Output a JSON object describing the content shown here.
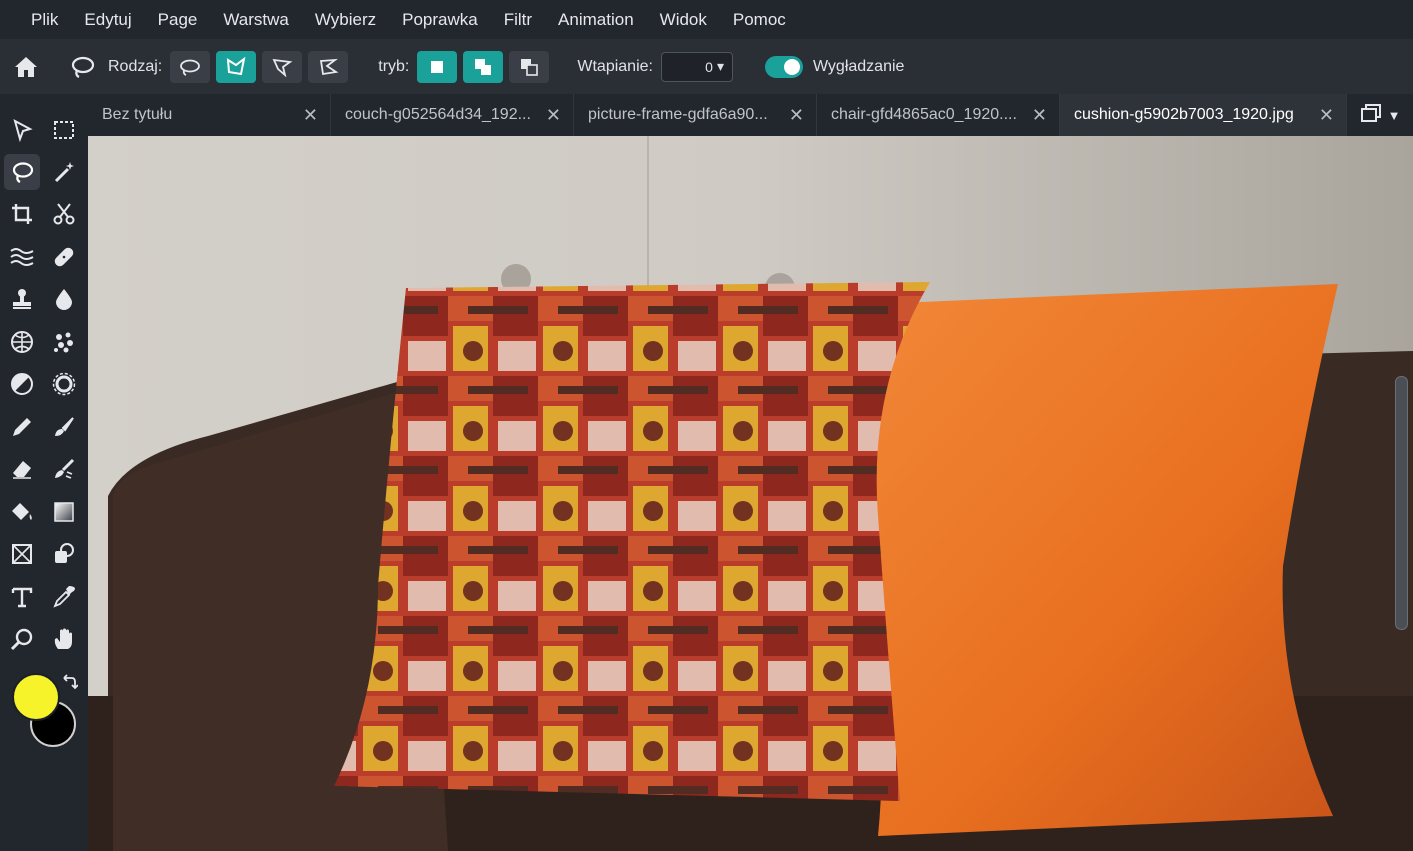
{
  "menu": [
    "Plik",
    "Edytuj",
    "Page",
    "Warstwa",
    "Wybierz",
    "Poprawka",
    "Filtr",
    "Animation",
    "Widok",
    "Pomoc"
  ],
  "options": {
    "type_label": "Rodzaj:",
    "mode_label": "tryb:",
    "feather_label": "Wtapianie:",
    "feather_value": "0",
    "smoothing_label": "Wygładzanie",
    "smoothing_on": true
  },
  "tabs": [
    {
      "label": "Bez tytułu",
      "active": false
    },
    {
      "label": "couch-g052564d34_192...",
      "active": false
    },
    {
      "label": "picture-frame-gdfa6a90...",
      "active": false
    },
    {
      "label": "chair-gfd4865ac0_1920....",
      "active": false
    },
    {
      "label": "cushion-g5902b7003_1920.jpg",
      "active": true
    }
  ],
  "tools": [
    "select-arrow-icon",
    "marquee-icon",
    "lasso-icon",
    "magic-wand-icon",
    "crop-icon",
    "scissors-icon",
    "liquify-icon",
    "heal-bandage-icon",
    "stamp-icon",
    "blur-drop-icon",
    "sphere-icon",
    "particles-icon",
    "dodge-icon",
    "sponge-icon",
    "pencil-icon",
    "brush-icon",
    "eraser-icon",
    "smudge-brush-icon",
    "bucket-icon",
    "gradient-icon",
    "transform-icon",
    "shape-icon",
    "text-icon",
    "eyedropper-icon",
    "zoom-icon",
    "hand-icon"
  ],
  "colors": {
    "foreground": "#f6f32a",
    "background": "#000000",
    "accent": "#1aa19a"
  }
}
